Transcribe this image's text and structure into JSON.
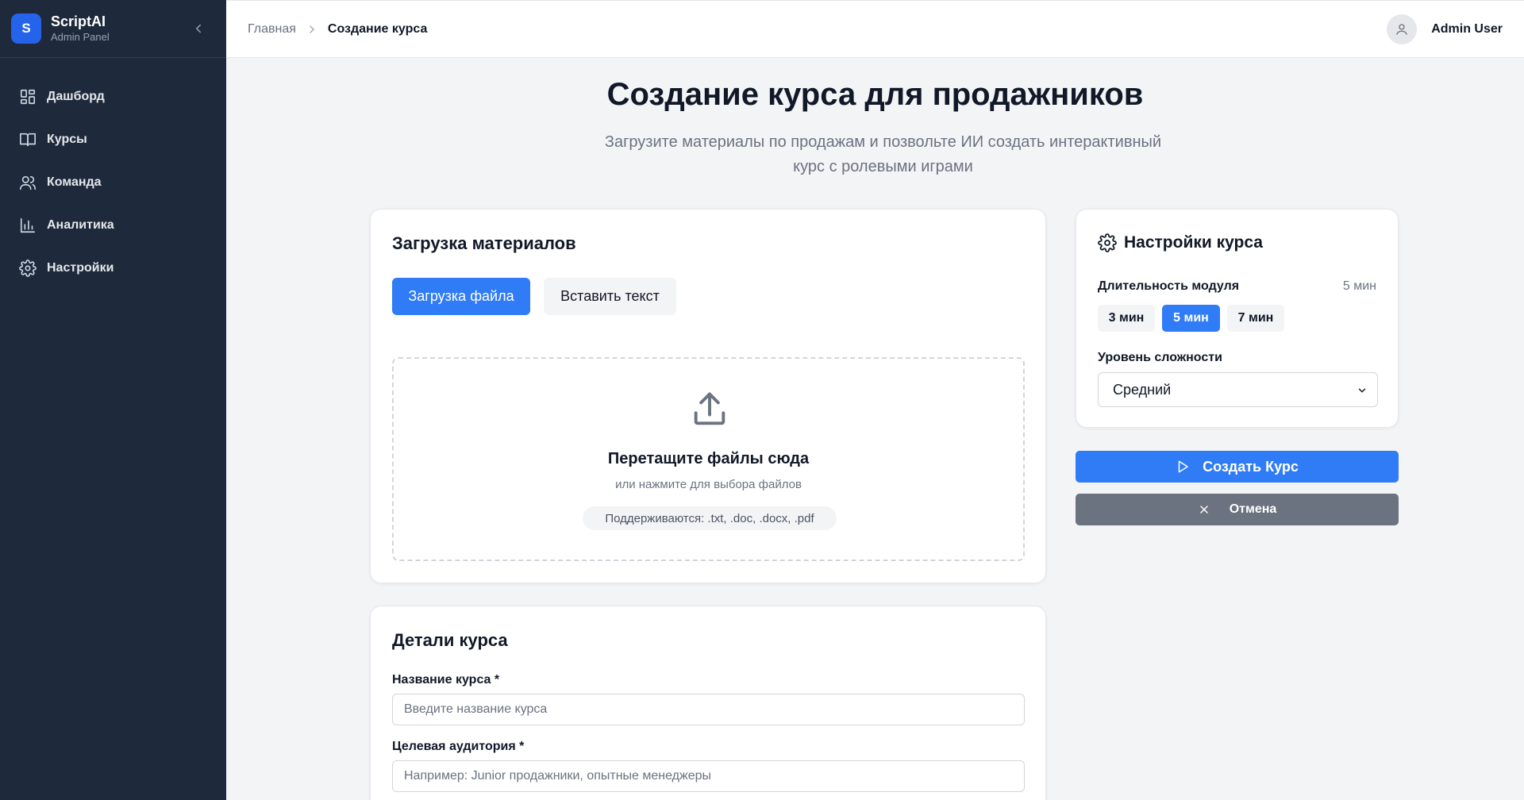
{
  "sidebar": {
    "logo_letter": "S",
    "brand_name": "ScriptAI",
    "brand_sub": "Admin Panel",
    "items": [
      {
        "label": "Дашборд",
        "icon": "dashboard-icon"
      },
      {
        "label": "Курсы",
        "icon": "book-icon"
      },
      {
        "label": "Команда",
        "icon": "users-icon"
      },
      {
        "label": "Аналитика",
        "icon": "chart-icon"
      },
      {
        "label": "Настройки",
        "icon": "gear-icon"
      }
    ]
  },
  "topbar": {
    "breadcrumb_home": "Главная",
    "breadcrumb_current": "Создание курса",
    "user_name": "Admin User"
  },
  "page": {
    "title": "Создание курса для продажников",
    "subtitle": "Загрузите материалы по продажам и позвольте ИИ создать интерактивный курс с ролевыми играми"
  },
  "upload": {
    "title": "Загрузка материалов",
    "tab_file": "Загрузка файла",
    "tab_text": "Вставить текст",
    "drop_title": "Перетащите файлы сюда",
    "drop_sub": "или нажмите для выбора файлов",
    "supported": "Поддерживаются: .txt, .doc, .docx, .pdf"
  },
  "details": {
    "title": "Детали курса",
    "name_label": "Название курса *",
    "name_placeholder": "Введите название курса",
    "audience_label": "Целевая аудитория *",
    "audience_placeholder": "Например: Junior продажники, опытные менеджеры"
  },
  "settings": {
    "title": "Настройки курса",
    "duration_label": "Длительность модуля",
    "duration_value": "5 мин",
    "duration_options": [
      "3 мин",
      "5 мин",
      "7 мин"
    ],
    "duration_selected": "5 мин",
    "level_label": "Уровень сложности",
    "level_value": "Средний"
  },
  "actions": {
    "create": "Создать Курс",
    "cancel": "Отмена"
  },
  "colors": {
    "sidebar_bg": "#1e2a3b",
    "accent": "#2f7cf6",
    "cancel_bg": "#6b7280"
  }
}
